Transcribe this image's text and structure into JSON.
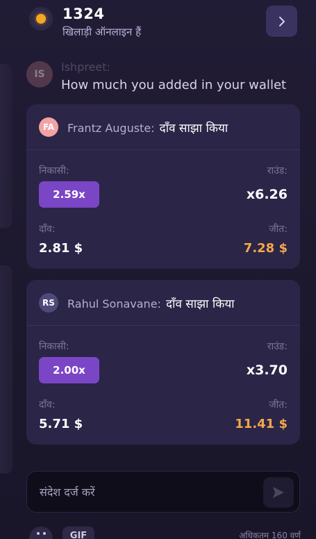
{
  "header": {
    "online_count": "1324",
    "online_label": "खिलाड़ी ऑनलाइन हैं",
    "next_icon": "chevron-right-icon"
  },
  "faded_message": {
    "avatar_initials": "IS",
    "name": "Ishpreet:",
    "text": "How much you added in your wallet"
  },
  "bets": [
    {
      "avatar_initials": "FA",
      "avatar_bg": "#f2a3a3",
      "avatar_fg": "#ffffff",
      "name": "Frantz Auguste:",
      "action": "दाँव साझा किया",
      "cashout_label": "निकासी:",
      "round_label": "राउंड:",
      "cashout_value": "2.59x",
      "round_value": "x6.26",
      "bet_label": "दाँव:",
      "win_label": "जीत:",
      "bet_value": "2.81 $",
      "win_value": "7.28 $"
    },
    {
      "avatar_initials": "RS",
      "avatar_bg": "#4d4a7a",
      "avatar_fg": "#ffffff",
      "name": "Rahul Sonavane:",
      "action": "दाँव साझा किया",
      "cashout_label": "निकासी:",
      "round_label": "राउंड:",
      "cashout_value": "2.00x",
      "round_value": "x3.70",
      "bet_label": "दाँव:",
      "win_label": "जीत:",
      "bet_value": "5.71 $",
      "win_value": "11.41 $"
    }
  ],
  "composer": {
    "placeholder": "संदेश दर्ज करें",
    "send_icon": "send-icon",
    "emoji_icon": "emoji-icon",
    "gif_label": "GIF",
    "char_limit": "अधिकतम 160 वर्ण"
  },
  "colors": {
    "background": "#1e1a30",
    "card": "#2b2547",
    "accent": "#7b46c6",
    "win": "#f4a84a"
  }
}
